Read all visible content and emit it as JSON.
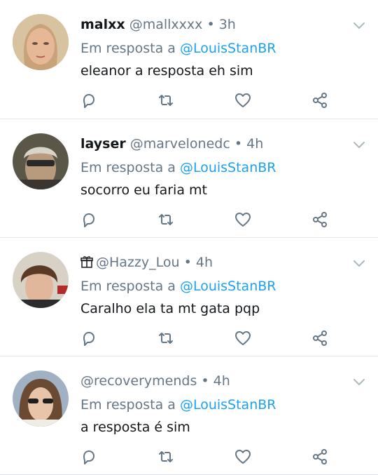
{
  "colors": {
    "accent": "#1da1f2",
    "muted": "#657786",
    "text": "#14171a",
    "divider": "#e1e8ed"
  },
  "icons": {
    "more": "chevron-down-icon",
    "reply": "reply-icon",
    "retweet": "retweet-icon",
    "like": "heart-icon",
    "share": "share-icon",
    "emoji": "wrapped-gift-icon"
  },
  "tweets": [
    {
      "name": "malxx",
      "handle": "@mallxxxx",
      "dot": "•",
      "time": "3h",
      "reply_prefix": "Em resposta a",
      "reply_to": "@LouisStanBR",
      "text": "eleanor a resposta eh sim"
    },
    {
      "name": "layser",
      "handle": "@marvelonedc",
      "dot": "•",
      "time": "4h",
      "reply_prefix": "Em resposta a",
      "reply_to": "@LouisStanBR",
      "text": "socorro eu faria mt"
    },
    {
      "name": "",
      "handle": "@Hazzy_Lou",
      "dot": "•",
      "time": "4h",
      "reply_prefix": "Em resposta a",
      "reply_to": "@LouisStanBR",
      "text": "Caralho ela ta mt gata pqp"
    },
    {
      "name": "",
      "handle": "@recoverymends",
      "dot": "•",
      "time": "4h",
      "reply_prefix": "Em resposta a",
      "reply_to": "@LouisStanBR",
      "text": "a resposta é sim"
    }
  ]
}
